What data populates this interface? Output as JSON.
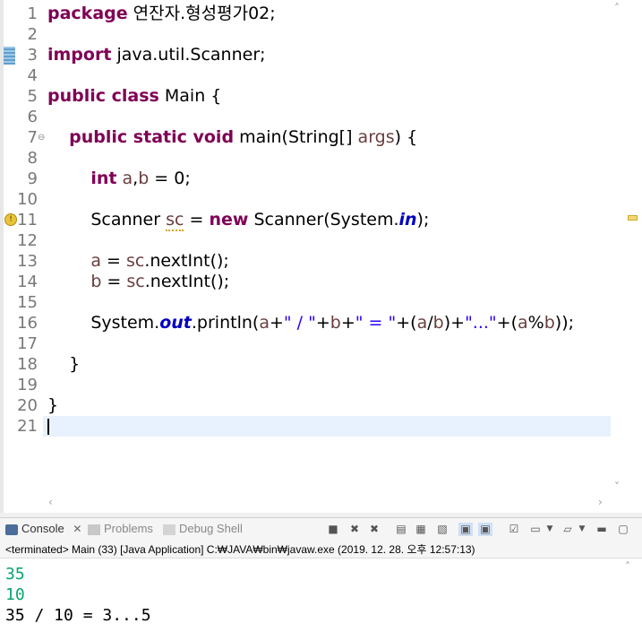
{
  "editor": {
    "lines": [
      {
        "n": "1",
        "tokens": [
          {
            "t": "package",
            "c": "kw"
          },
          {
            "t": " 연잔자.형성평가02;",
            "c": "plain"
          }
        ]
      },
      {
        "n": "2",
        "tokens": []
      },
      {
        "n": "3",
        "tokens": [
          {
            "t": "import",
            "c": "kw"
          },
          {
            "t": " java.util.Scanner;",
            "c": "plain"
          }
        ]
      },
      {
        "n": "4",
        "tokens": []
      },
      {
        "n": "5",
        "tokens": [
          {
            "t": "public class",
            "c": "kw"
          },
          {
            "t": " Main {",
            "c": "plain"
          }
        ]
      },
      {
        "n": "6",
        "tokens": []
      },
      {
        "n": "7",
        "fold": "⊖",
        "tokens": [
          {
            "t": "    ",
            "c": "plain"
          },
          {
            "t": "public static void",
            "c": "kw"
          },
          {
            "t": " main(String[] ",
            "c": "plain"
          },
          {
            "t": "args",
            "c": "var"
          },
          {
            "t": ") {",
            "c": "plain"
          }
        ]
      },
      {
        "n": "8",
        "tokens": []
      },
      {
        "n": "9",
        "tokens": [
          {
            "t": "        ",
            "c": "plain"
          },
          {
            "t": "int",
            "c": "kw"
          },
          {
            "t": " ",
            "c": "plain"
          },
          {
            "t": "a",
            "c": "var"
          },
          {
            "t": ",",
            "c": "plain"
          },
          {
            "t": "b",
            "c": "var"
          },
          {
            "t": " = 0;",
            "c": "plain"
          }
        ]
      },
      {
        "n": "10",
        "tokens": []
      },
      {
        "n": "11",
        "warn": true,
        "tokens": [
          {
            "t": "        Scanner ",
            "c": "plain"
          },
          {
            "t": "sc",
            "c": "var squiggle"
          },
          {
            "t": " = ",
            "c": "plain"
          },
          {
            "t": "new",
            "c": "kw"
          },
          {
            "t": " Scanner(System.",
            "c": "plain"
          },
          {
            "t": "in",
            "c": "fld"
          },
          {
            "t": ");",
            "c": "plain"
          }
        ]
      },
      {
        "n": "12",
        "tokens": []
      },
      {
        "n": "13",
        "tokens": [
          {
            "t": "        ",
            "c": "plain"
          },
          {
            "t": "a",
            "c": "var"
          },
          {
            "t": " = ",
            "c": "plain"
          },
          {
            "t": "sc",
            "c": "var"
          },
          {
            "t": ".nextInt();",
            "c": "plain"
          }
        ]
      },
      {
        "n": "14",
        "tokens": [
          {
            "t": "        ",
            "c": "plain"
          },
          {
            "t": "b",
            "c": "var"
          },
          {
            "t": " = ",
            "c": "plain"
          },
          {
            "t": "sc",
            "c": "var"
          },
          {
            "t": ".nextInt();",
            "c": "plain"
          }
        ]
      },
      {
        "n": "15",
        "tokens": []
      },
      {
        "n": "16",
        "tokens": [
          {
            "t": "        System.",
            "c": "plain"
          },
          {
            "t": "out",
            "c": "fld"
          },
          {
            "t": ".println(",
            "c": "plain"
          },
          {
            "t": "a",
            "c": "var"
          },
          {
            "t": "+",
            "c": "plain"
          },
          {
            "t": "\" / \"",
            "c": "str"
          },
          {
            "t": "+",
            "c": "plain"
          },
          {
            "t": "b",
            "c": "var"
          },
          {
            "t": "+",
            "c": "plain"
          },
          {
            "t": "\" = \"",
            "c": "str"
          },
          {
            "t": "+(",
            "c": "plain"
          },
          {
            "t": "a",
            "c": "var"
          },
          {
            "t": "/",
            "c": "plain"
          },
          {
            "t": "b",
            "c": "var"
          },
          {
            "t": ")+",
            "c": "plain"
          },
          {
            "t": "\"...\"",
            "c": "str"
          },
          {
            "t": "+(",
            "c": "plain"
          },
          {
            "t": "a",
            "c": "var"
          },
          {
            "t": "%",
            "c": "plain"
          },
          {
            "t": "b",
            "c": "var"
          },
          {
            "t": "));",
            "c": "plain"
          }
        ]
      },
      {
        "n": "17",
        "tokens": []
      },
      {
        "n": "18",
        "tokens": [
          {
            "t": "    }",
            "c": "plain"
          }
        ]
      },
      {
        "n": "19",
        "tokens": []
      },
      {
        "n": "20",
        "tokens": [
          {
            "t": "}",
            "c": "plain"
          }
        ]
      },
      {
        "n": "21",
        "current": true,
        "tokens": []
      }
    ]
  },
  "console": {
    "tabs": {
      "console": "Console",
      "problems": "Problems",
      "debug_shell": "Debug Shell"
    },
    "status": "<terminated> Main (33) [Java Application] C:₩JAVA₩bin₩javaw.exe (2019. 12. 28. 오후 12:57:13)",
    "output": [
      {
        "text": "35",
        "kind": "in"
      },
      {
        "text": "10",
        "kind": "in"
      },
      {
        "text": "35 / 10 = 3...5",
        "kind": "outc"
      }
    ]
  },
  "colors": {
    "keyword": "#7f0055",
    "string": "#2a00ff",
    "field": "#0000c0",
    "input": "#0aa372",
    "current_line": "#e8f2fe"
  }
}
